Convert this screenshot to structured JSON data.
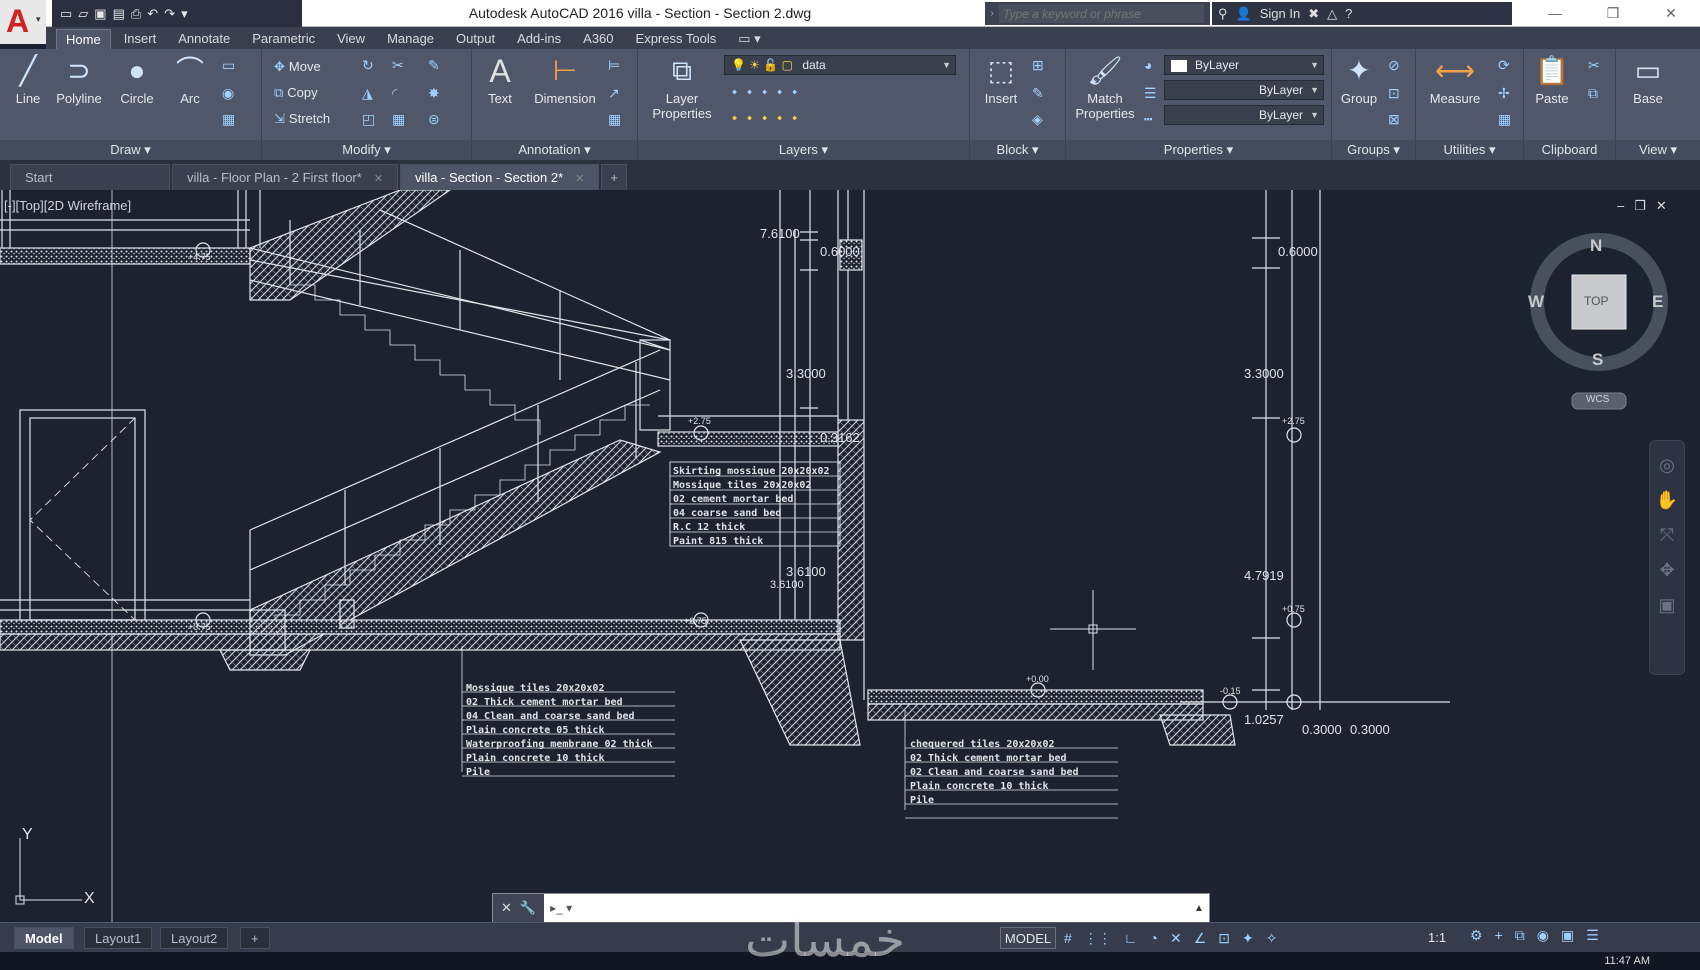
{
  "app": {
    "title": "Autodesk AutoCAD 2016   villa - Section - Section 2.dwg",
    "search_placeholder": "Type a keyword or phrase",
    "sign_in": "Sign In"
  },
  "ribbon_tabs": [
    "Home",
    "Insert",
    "Annotate",
    "Parametric",
    "View",
    "Manage",
    "Output",
    "Add-ins",
    "A360",
    "Express Tools"
  ],
  "panels": {
    "draw": {
      "title": "Draw",
      "line": "Line",
      "polyline": "Polyline",
      "circle": "Circle",
      "arc": "Arc"
    },
    "modify": {
      "title": "Modify",
      "move": "Move",
      "copy": "Copy",
      "stretch": "Stretch"
    },
    "annotation": {
      "title": "Annotation",
      "text": "Text",
      "dimension": "Dimension"
    },
    "layers": {
      "title": "Layers",
      "layer_properties_1": "Layer",
      "layer_properties_2": "Properties",
      "current_layer": "data"
    },
    "block": {
      "title": "Block",
      "insert": "Insert"
    },
    "properties": {
      "title": "Properties",
      "match_1": "Match",
      "match_2": "Properties",
      "color": "ByLayer",
      "linetype": "ByLayer",
      "lineweight": "ByLayer"
    },
    "groups": {
      "title": "Groups",
      "group": "Group"
    },
    "utilities": {
      "title": "Utilities",
      "measure": "Measure"
    },
    "clipboard": {
      "title": "Clipboard",
      "paste": "Paste"
    },
    "view": {
      "title": "View",
      "base": "Base"
    }
  },
  "doc_tabs": [
    "Start",
    "villa - Floor Plan - 2 First floor*",
    "villa - Section - Section 2*"
  ],
  "viewport": {
    "label": "[-][Top][2D Wireframe]",
    "compass": {
      "n": "N",
      "s": "S",
      "e": "E",
      "w": "W",
      "top": "TOP",
      "wcs": "WCS"
    }
  },
  "drawing": {
    "dims_left": [
      "7.6100",
      "0.6000",
      "3.3000",
      "0.3162",
      "3.6100",
      "3.6100"
    ],
    "dims_right": [
      "0.6000",
      "3.3000",
      "4.7919",
      "1.0257",
      "0.3000",
      "0.3000"
    ],
    "levels": [
      "+4.75",
      "+0.75",
      "+2.75",
      "+0.75",
      "+0.00",
      "-0.15",
      "+2.75",
      "+0.75"
    ],
    "note_box_1": [
      "Skirting mossique  20x20x02",
      "Mossique tiles  20x20x02",
      "02 cement mortar bed",
      "04 coarse sand bed",
      "R.C 12 thick",
      "Paint 815 thick"
    ],
    "note_box_2": [
      "Mossique tiles  20x20x02",
      "02 Thick cement mortar bed",
      "04 Clean and coarse sand bed",
      "Plain concrete 05 thick",
      "Waterproofing membrane 02 thick",
      "Plain concrete 10 thick",
      "Pile"
    ],
    "note_box_3": [
      "chequered tiles  20x20x02",
      "02 Thick cement mortar bed",
      "02 Clean and coarse sand bed",
      "Plain concrete 10 thick",
      "Pile"
    ],
    "ucs_x": "X",
    "ucs_y": "Y"
  },
  "status": {
    "layout_tabs": [
      "Model",
      "Layout1",
      "Layout2"
    ],
    "model": "MODEL",
    "scale": "1:1",
    "clock": "11:47 AM"
  },
  "watermark": "خمسات"
}
